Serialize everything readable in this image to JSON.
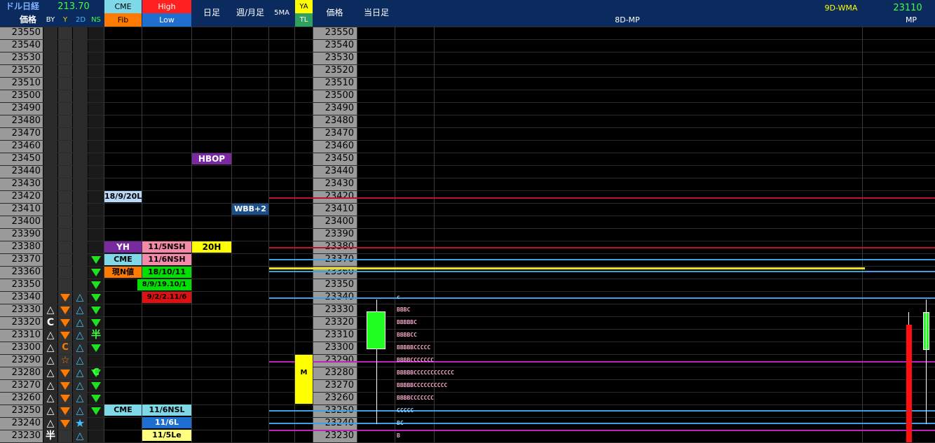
{
  "header": {
    "dollar_nikkei_label": "ドル日経",
    "dollar_nikkei_value": "213.70",
    "price_label": "価格",
    "col_by": "BY",
    "col_y": "Y",
    "col_2d": "2D",
    "col_ns": "NS",
    "cme_label": "CME",
    "fib_label": "Fib",
    "high_label": "High",
    "low_label": "Low",
    "daily_label": "日足",
    "weekly_monthly_label": "週/月足",
    "ma5_label": "5MA",
    "ya_label": "YA",
    "tl_label": "TL",
    "price_label2": "価格",
    "today_label": "当日足",
    "mp8d_label": "8D-MP",
    "wma9d_label": "9D-WMA",
    "mp_value": "23110",
    "mp_label": "MP"
  },
  "prices": [
    "23550",
    "23540",
    "23530",
    "23520",
    "23510",
    "23500",
    "23490",
    "23480",
    "23470",
    "23460",
    "23450",
    "23440",
    "23430",
    "23420",
    "23410",
    "23400",
    "23390",
    "23380",
    "23370",
    "23360",
    "23350",
    "23340",
    "23330",
    "23320",
    "23310",
    "23300",
    "23290",
    "23280",
    "23270",
    "23260",
    "23250",
    "23240",
    "23230"
  ],
  "markers": {
    "hbop": "HBOP",
    "date_18920": "18/9/20L",
    "wbb": "WBB+2",
    "yh": "YH",
    "ns_5h": "11/5NSH",
    "h20": "20H",
    "cme_mid": "CME",
    "ns_6h": "11/6NSH",
    "genn": "現N値",
    "d181011": "18/10/11",
    "d1910": "8/9/19.10/1",
    "d2211": "9/2/2.11/6",
    "ya_m": "M",
    "cme_low": "CME",
    "nsl": "11/6NSL",
    "l6": "11/6L",
    "le5": "11/5Le"
  },
  "symbols": {
    "by": [
      {
        "row": 22,
        "t": "△"
      },
      {
        "row": 23,
        "t": "C"
      },
      {
        "row": 24,
        "t": "△"
      },
      {
        "row": 25,
        "t": "△"
      },
      {
        "row": 26,
        "t": "△"
      },
      {
        "row": 27,
        "t": "△"
      },
      {
        "row": 28,
        "t": "△"
      },
      {
        "row": 29,
        "t": "△"
      },
      {
        "row": 30,
        "t": "△"
      },
      {
        "row": 31,
        "t": "△"
      },
      {
        "row": 32,
        "t": "半"
      }
    ],
    "y_c": "C",
    "y_star": "☆",
    "d2_star": "★",
    "ns_han": "半",
    "ns_c": "C",
    "tri_open": "△"
  },
  "tpo": {
    "r21": "c",
    "r22": "BBBC",
    "r23": "BBBBBC",
    "r24": "BBBBCC",
    "r25": "BBBBBCCCCC",
    "r26": "BBBBCCCCCCC",
    "r27": "BBBBBCCCCCCCCCCCC",
    "r28": "BBBBBCCCCCCCCCC",
    "r29": "BBBBCCCCCCC",
    "r30": "CCCCC",
    "r31": "BC",
    "r32": "B"
  },
  "colors": {
    "price_bg": "#9a9a9a",
    "cyan": "#7fd8e8",
    "red": "#ff2020",
    "purple": "#7a2aa0",
    "pink": "#f48aa8",
    "yellow": "#ffff00",
    "green": "#00ff00",
    "orange": "#ff7a00",
    "blue": "#1e6fd0"
  }
}
